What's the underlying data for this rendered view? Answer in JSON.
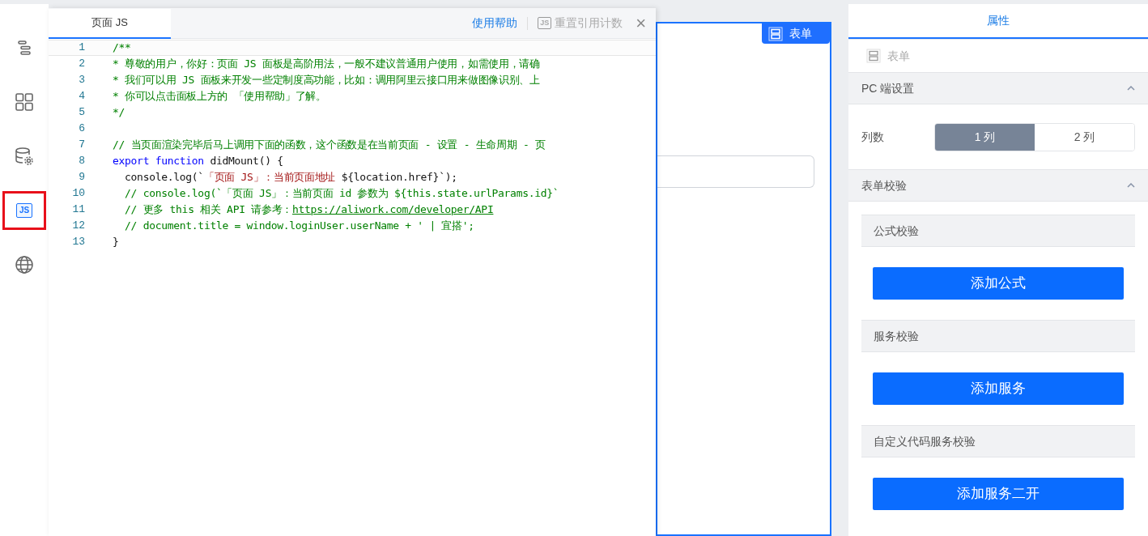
{
  "left_toolbar": {
    "items": [
      {
        "kind": "outline",
        "selected": false
      },
      {
        "kind": "components",
        "selected": false
      },
      {
        "kind": "datasource",
        "selected": false
      },
      {
        "kind": "js",
        "text": "JS",
        "selected": true
      },
      {
        "kind": "globe",
        "selected": false
      }
    ]
  },
  "code_panel": {
    "tab": {
      "label": "页面 JS",
      "selected": true
    },
    "help_link": "使用帮助",
    "reset_button": {
      "icon_text": "JS",
      "label": "重置引用计数",
      "disabled": true
    },
    "close": "×",
    "lines": [
      {
        "number": "1",
        "current": true,
        "tokens": [
          {
            "kind": "comment",
            "text": "/**"
          }
        ]
      },
      {
        "number": "2",
        "current": false,
        "tokens": [
          {
            "kind": "comment",
            "text": "* 尊敬的用户，你好：页面 JS 面板是高阶用法，一般不建议普通用户使用，如需使用，请确"
          }
        ]
      },
      {
        "number": "3",
        "current": false,
        "tokens": [
          {
            "kind": "comment",
            "text": "* 我们可以用 JS 面板来开发一些定制度高功能，比如：调用阿里云接口用来做图像识别、上"
          }
        ]
      },
      {
        "number": "4",
        "current": false,
        "tokens": [
          {
            "kind": "comment",
            "text": "* 你可以点击面板上方的 「使用帮助」了解。"
          }
        ]
      },
      {
        "number": "5",
        "current": false,
        "tokens": [
          {
            "kind": "comment",
            "text": "*/"
          }
        ]
      },
      {
        "number": "6",
        "current": false
      },
      {
        "number": "7",
        "current": false,
        "tokens": [
          {
            "kind": "comment",
            "text": "// 当页面渲染完毕后马上调用下面的函数，这个函数是在当前页面 - 设置 - 生命周期 - 页"
          }
        ]
      },
      {
        "number": "8",
        "current": false,
        "tokens": [
          {
            "kind": "keyword",
            "text": "export function"
          },
          {
            "kind": "plain",
            "text": " didMount() {"
          }
        ]
      },
      {
        "number": "9",
        "current": false,
        "tokens": [
          {
            "kind": "plain",
            "text": "  console.log(`"
          },
          {
            "kind": "string",
            "text": "「页面 JS」：当前页面地址"
          },
          {
            "kind": "plain",
            "text": " ${location.href}`);"
          }
        ]
      },
      {
        "number": "10",
        "current": false,
        "tokens": [
          {
            "kind": "comment",
            "text": "  // console.log(`「页面 JS」：当前页面 id 参数为 ${this.state.urlParams.id}`"
          }
        ]
      },
      {
        "number": "11",
        "current": false,
        "tokens": [
          {
            "kind": "comment",
            "text": "  // 更多 this 相关 API 请参考："
          },
          {
            "kind": "link",
            "text": "https://aliwork.com/developer/API"
          }
        ]
      },
      {
        "number": "12",
        "current": false,
        "tokens": [
          {
            "kind": "comment",
            "text": "  // document.title = window.loginUser.userName + ' | 宜搭';"
          }
        ]
      },
      {
        "number": "13",
        "current": false,
        "tokens": [
          {
            "kind": "plain",
            "text": "}"
          }
        ]
      }
    ]
  },
  "canvas": {
    "form_badge": "表单"
  },
  "properties_panel": {
    "tabs": [
      {
        "label": "属性",
        "selected": true
      }
    ],
    "component": "表单",
    "sections": [
      {
        "title": "PC 端设置",
        "expanded": true,
        "kind": "segmented",
        "field_label": "列数",
        "options": [
          {
            "label": "1 列",
            "selected": true
          },
          {
            "label": "2 列",
            "selected": false
          }
        ]
      },
      {
        "title": "表单校验",
        "expanded": true,
        "kind": "validation",
        "groups": [
          {
            "title": "公式校验",
            "button": "添加公式"
          },
          {
            "title": "服务校验",
            "button": "添加服务"
          },
          {
            "title": "自定义代码服务校验",
            "button": "添加服务二开"
          }
        ]
      }
    ]
  }
}
